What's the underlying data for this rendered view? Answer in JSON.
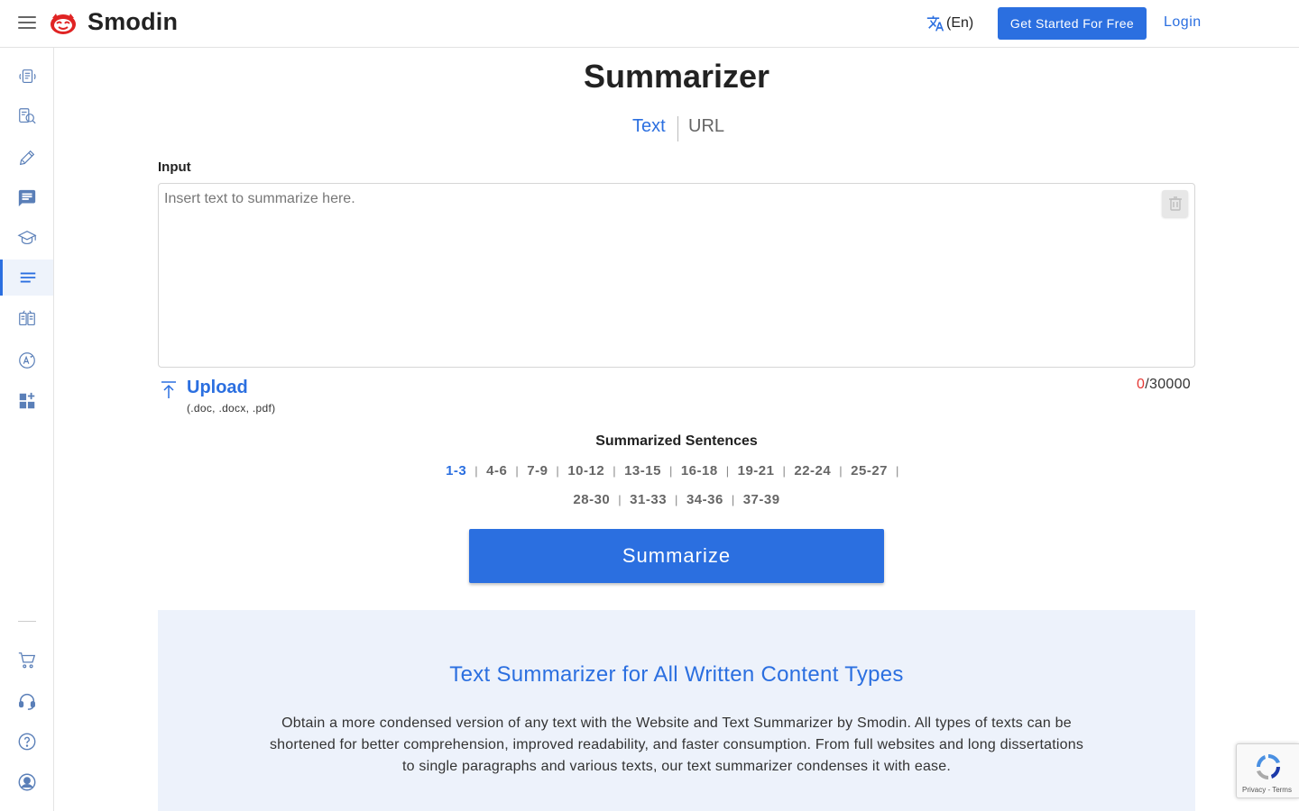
{
  "header": {
    "brand": "Smodin",
    "language": "(En)",
    "get_started": "Get Started For Free",
    "login": "Login"
  },
  "sidebar": {
    "items": [
      {
        "icon": "document-rewrite-icon"
      },
      {
        "icon": "plagiarism-search-icon"
      },
      {
        "icon": "pencil-writer-icon"
      },
      {
        "icon": "chat-icon"
      },
      {
        "icon": "graduation-cap-icon"
      },
      {
        "icon": "summarizer-lines-icon",
        "active": true
      },
      {
        "icon": "translate-books-icon"
      },
      {
        "icon": "grammar-check-icon"
      },
      {
        "icon": "apps-grid-icon"
      }
    ],
    "bottom_items": [
      {
        "icon": "cart-icon"
      },
      {
        "icon": "support-headset-icon"
      },
      {
        "icon": "help-icon"
      },
      {
        "icon": "account-icon"
      }
    ]
  },
  "main": {
    "title": "Summarizer",
    "tabs": [
      {
        "label": "Text",
        "active": true
      },
      {
        "label": "URL",
        "active": false
      }
    ],
    "input_label": "Input",
    "input_placeholder": "Insert text to summarize here.",
    "upload_label": "Upload",
    "upload_hint": "(.doc, .docx, .pdf)",
    "counter_current": "0",
    "counter_max": "/30000",
    "sentences_label": "Summarized Sentences",
    "sentence_options_row1": [
      "1-3",
      "4-6",
      "7-9",
      "10-12",
      "13-15",
      "16-18",
      "19-21",
      "22-24",
      "25-27"
    ],
    "sentence_options_row2": [
      "28-30",
      "31-33",
      "34-36",
      "37-39"
    ],
    "selected_option": "1-3",
    "summarize_button": "Summarize"
  },
  "info": {
    "title": "Text Summarizer for All Written Content Types",
    "text": "Obtain a more condensed version of any text with the Website and Text Summarizer by Smodin. All types of texts can be shortened for better comprehension, improved readability, and faster consumption. From full websites and long dissertations to single paragraphs and various texts, our text summarizer condenses it with ease."
  },
  "recaptcha": {
    "links": "Privacy - Terms"
  },
  "colors": {
    "accent": "#2b6fe0",
    "counter_zero": "#e53935",
    "info_bg": "#edf2fb"
  }
}
